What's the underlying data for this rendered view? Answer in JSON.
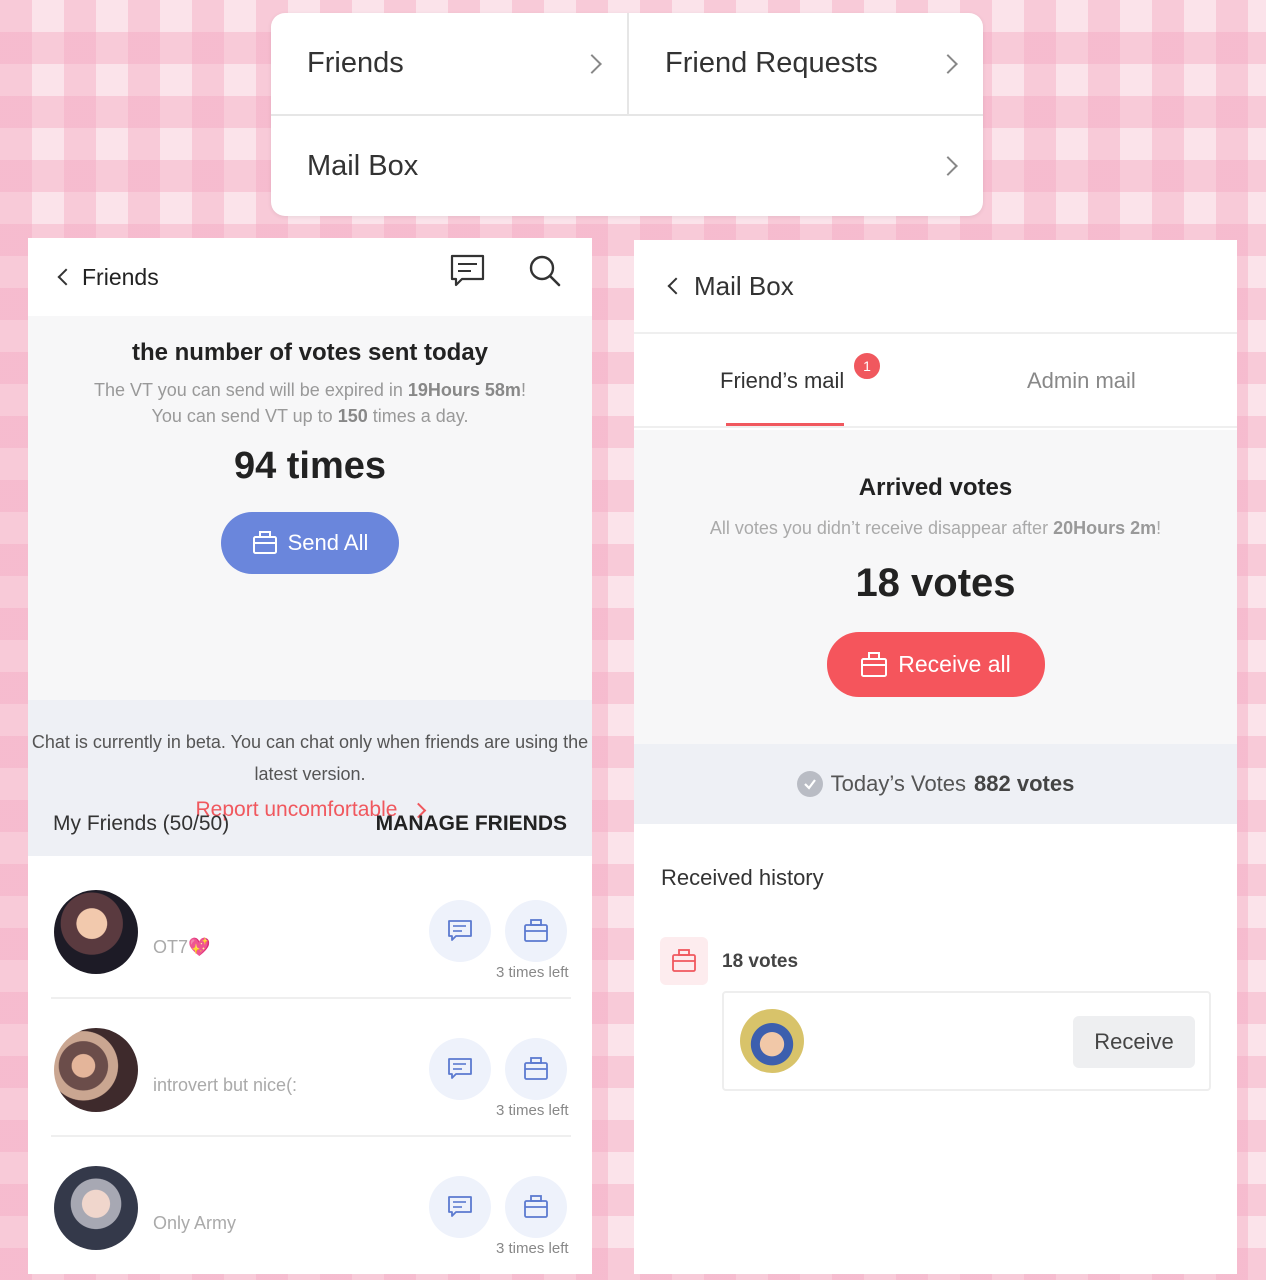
{
  "menu": {
    "friends": "Friends",
    "friend_requests": "Friend Requests",
    "mail_box": "Mail Box"
  },
  "friends_screen": {
    "back_label": "Friends",
    "votes_title": "the number of votes sent today",
    "expire_prefix": "The VT you can send will be expired in ",
    "expire_time": "19Hours 58m",
    "expire_suffix": "!",
    "limit_prefix": "You can send VT up to ",
    "limit_value": "150",
    "limit_suffix": " times a day.",
    "sent_count": "94 times",
    "send_all_label": "Send All",
    "beta_notice": "Chat is currently in beta. You can chat only when friends are using the latest version.",
    "report_label": "Report uncomfortable",
    "my_friends_label": "My Friends  (50/50)",
    "manage_label": "MANAGE FRIENDS",
    "friends": [
      {
        "name": "OT7💖",
        "times_left": "3 times left"
      },
      {
        "name": "introvert but nice(:",
        "times_left": "3 times left"
      },
      {
        "name": "Only Army",
        "times_left": "3 times left"
      }
    ]
  },
  "mail_screen": {
    "back_label": "Mail Box",
    "tabs": [
      {
        "label": "Friend’s mail",
        "badge": "1"
      },
      {
        "label": "Admin mail"
      }
    ],
    "arrived_title": "Arrived votes",
    "arrived_prefix": "All votes you didn’t receive disappear after ",
    "arrived_time": "20Hours 2m",
    "arrived_suffix": "!",
    "arrived_count": "18 votes",
    "receive_all_label": "Receive all",
    "today_prefix": "Today’s Votes ",
    "today_value": "882 votes",
    "history_title": "Received history",
    "history_votes": "18 votes",
    "receive_label": "Receive"
  },
  "colors": {
    "accent_red": "#f0585e",
    "send_blue": "#6a86dc",
    "icon_blue": "#5b7ad0"
  }
}
